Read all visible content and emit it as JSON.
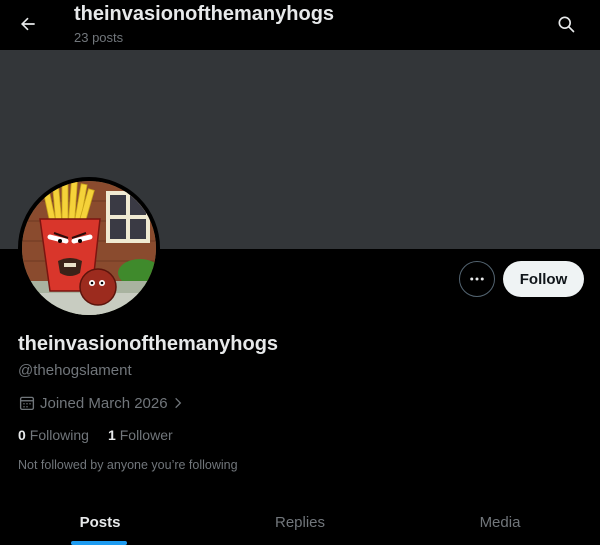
{
  "header": {
    "title": "theinvasionofthemanyhogs",
    "post_count": "23 posts",
    "back_icon": "arrow-left-icon",
    "search_icon": "search-icon"
  },
  "banner": {
    "color": "#333639"
  },
  "profile": {
    "display_name": "theinvasionofthemanyhogs",
    "handle": "@thehogslament",
    "joined": "Joined March 2026",
    "following_count": "0",
    "following_label": "Following",
    "followers_count": "1",
    "followers_label": "Follower",
    "mutuals_note": "Not followed by anyone you’re following"
  },
  "actions": {
    "more_icon": "more-dots-icon",
    "follow_label": "Follow"
  },
  "tabs": [
    {
      "label": "Posts",
      "active": true
    },
    {
      "label": "Replies",
      "active": false
    },
    {
      "label": "Media",
      "active": false
    }
  ],
  "colors": {
    "background": "#000000",
    "primary_text": "#e7e9ea",
    "secondary_text": "#71767b",
    "accent": "#1d9bf0",
    "follow_button_bg": "#eff3f4"
  }
}
